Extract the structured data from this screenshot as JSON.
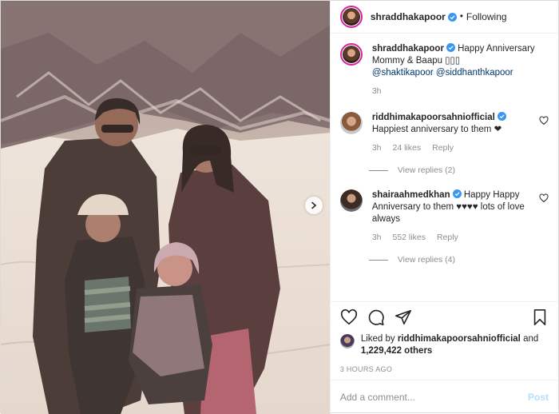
{
  "colors": {
    "accent": "#0095f6",
    "verified": "#3897f0",
    "text": "#262626",
    "muted": "#8e8e8e",
    "link": "#00376b"
  },
  "header": {
    "username": "shraddhakapoor",
    "separator": "•",
    "follow_status": "Following"
  },
  "caption": {
    "username": "shraddhakapoor",
    "text": "Happy Anniversary Mommy & Baapu",
    "emoji": "▯▯▯",
    "mentions": [
      "@shaktikapoor",
      "@siddhanthkapoor"
    ],
    "time": "3h"
  },
  "comments": [
    {
      "username": "riddhimakapoorsahniofficial",
      "text": "Happiest anniversary to them ❤",
      "time": "3h",
      "likes": "24 likes",
      "reply_label": "Reply",
      "view_replies": "View replies (2)"
    },
    {
      "username": "shairaahmedkhan",
      "text": "Happy Happy Anniversary to them ♥♥♥♥ lots of love always",
      "time": "3h",
      "likes": "552 likes",
      "reply_label": "Reply",
      "view_replies": "View replies (4)"
    }
  ],
  "likes": {
    "prefix": "Liked by",
    "user": "riddhimakapoorsahniofficial",
    "joiner": "and",
    "count": "1,229,422 others"
  },
  "timestamp": "3 HOURS AGO",
  "add_comment": {
    "placeholder": "Add a comment...",
    "post_label": "Post"
  },
  "icons": [
    "verified-icon",
    "heart-icon",
    "comment-icon",
    "share-icon",
    "bookmark-icon",
    "next-icon"
  ]
}
